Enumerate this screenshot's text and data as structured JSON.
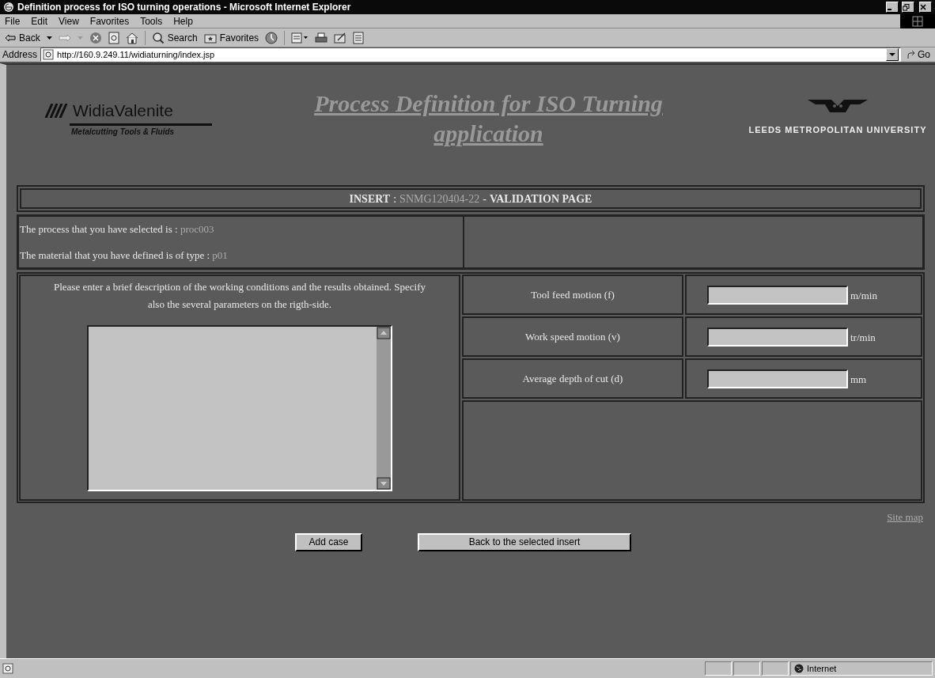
{
  "window": {
    "title": "Definition process for ISO turning operations - Microsoft Internet Explorer"
  },
  "menu": [
    "File",
    "Edit",
    "View",
    "Favorites",
    "Tools",
    "Help"
  ],
  "toolbar": {
    "back": "Back",
    "search": "Search",
    "favorites": "Favorites"
  },
  "address": {
    "label": "Address",
    "url": "http://160.9.249.11/widiaturning/index.jsp",
    "go": "Go"
  },
  "page": {
    "logo_left": {
      "name": "WidiaValenite",
      "tagline": "Metalcutting Tools & Fluids"
    },
    "title": "Process Definition for ISO Turning application",
    "logo_right": {
      "name": "LEEDS METROPOLITAN UNIVERSITY"
    },
    "header": {
      "prefix": "INSERT",
      "separator": ":",
      "insert_code": "SNMG120404-22",
      "dash": "-",
      "suffix": "VALIDATION PAGE"
    },
    "info": [
      {
        "label": "The process that you have selected is :",
        "value": "proc003"
      },
      {
        "label": "The material that you have defined is of type :",
        "value": "p01"
      }
    ],
    "description": "Please enter a brief description of the working conditions and the results obtained. Specify also the several parameters on the rigth-side.",
    "parameters": [
      {
        "label": "Tool feed motion (f)",
        "unit": "m/min"
      },
      {
        "label": "Work speed motion (v)",
        "unit": "tr/min"
      },
      {
        "label": "Average depth of cut (d)",
        "unit": "mm"
      }
    ],
    "site_map": "Site map",
    "buttons": [
      "Add case",
      "Back to the selected insert"
    ]
  },
  "status_bar": {
    "zone": "Internet"
  }
}
